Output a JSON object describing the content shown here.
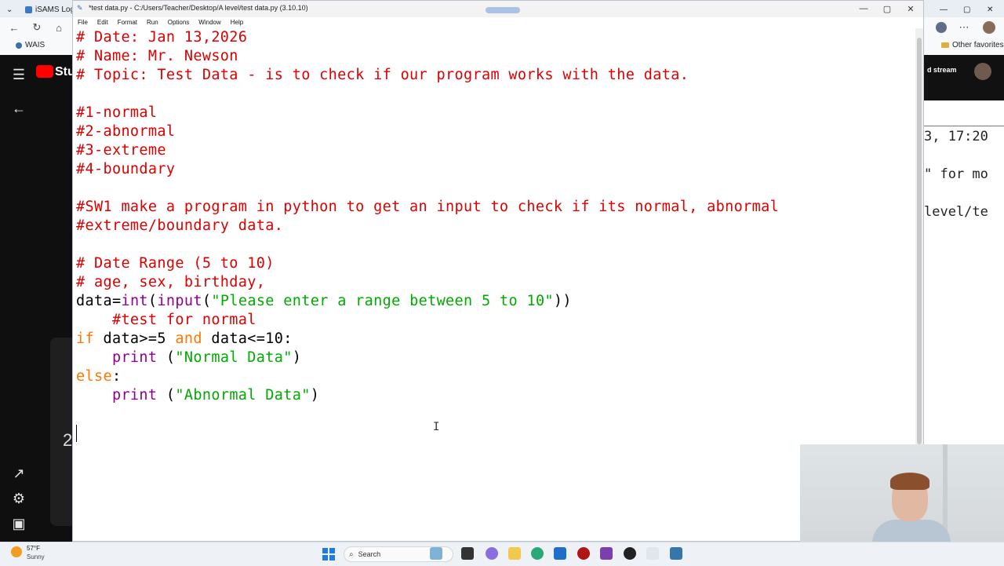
{
  "browser": {
    "tab1_label": "iSAMS Login",
    "back_label": "←",
    "bookmark_wais": "WAIS",
    "other_favorites": "Other favorites"
  },
  "left_app": {
    "brand": "Stu",
    "card_number": "2"
  },
  "right_app": {
    "lines": [
      "3, 17:20",
      "\" for mo",
      "level/te"
    ],
    "dstream_label": "d stream"
  },
  "idle": {
    "title": "*test data.py - C:/Users/Teacher/Desktop/A level/test data.py (3.10.10)",
    "menu": [
      "File",
      "Edit",
      "Format",
      "Run",
      "Options",
      "Window",
      "Help"
    ]
  },
  "code": {
    "l1": "# Date: Jan 13,2026",
    "l2": "# Name: Mr. Newson",
    "l3": "# Topic: Test Data - is to check if our program works with the data.",
    "l5": "#1-normal",
    "l6": "#2-abnormal",
    "l7": "#3-extreme",
    "l8": "#4-boundary",
    "l10": "#SW1 make a program in python to get an input to check if its normal, abnormal",
    "l11": "#extreme/boundary data.",
    "l13": "# Date Range (5 to 10)",
    "l14": "# age, sex, birthday,",
    "l15_a": "data=",
    "l15_b": "int",
    "l15_c": "(",
    "l15_d": "input",
    "l15_e": "(",
    "l15_f": "\"Please enter a range between 5 to 10\"",
    "l15_g": "))",
    "l16": "    #test for normal",
    "l17_a": "if",
    "l17_b": " data>=5 ",
    "l17_c": "and",
    "l17_d": " data<=10:",
    "l18_a": "    ",
    "l18_b": "print",
    "l18_c": " (",
    "l18_d": "\"Normal Data\"",
    "l18_e": ")",
    "l19_a": "else",
    "l19_b": ":",
    "l20_a": "    ",
    "l20_b": "print",
    "l20_c": " (",
    "l20_d": "\"Abnormal Data\"",
    "l20_e": ")"
  },
  "taskbar": {
    "weather_temp": "57°F",
    "weather_cond": "Sunny",
    "search_label": "Search"
  },
  "colors": {
    "comment": "#dd0000",
    "string": "#00aa00",
    "keyword": "#ff7700",
    "builtin": "#900090"
  }
}
